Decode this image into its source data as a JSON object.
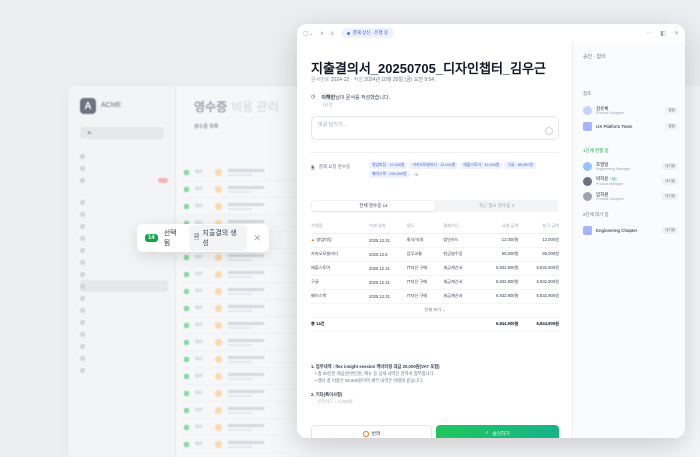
{
  "background": {
    "workspace": "ACME",
    "page_title": "영수증",
    "page_subtitle": "비용 관리",
    "tab_label": "영수증 목록",
    "row_status": "대기"
  },
  "toolbar": {
    "count": "14",
    "selected_label": "선택됨",
    "chip_label": "지출결의 생성"
  },
  "modal": {
    "status": "결재 상신 · 진행 중",
    "title": "지출결의서_20250705_디자인챕터_김우근",
    "meta_prefix": "문서번호",
    "doc_no": "2024-12",
    "meta_date_label": "작성",
    "meta_date": "2024년 10월 20일 (금) 오전 9:54",
    "activity_author": "이해빈",
    "activity_text": "님이 문서를 작성했습니다.",
    "activity_time": "1일 전",
    "comment_placeholder": "댓글 남기기…",
    "linked_label": "결재 요청 영수증",
    "linked_chips": [
      "영업미팅 · 12,000원",
      "카카오모빌리티 · 12,000원",
      "애플스토어 · 12,000원",
      "구글 · 89,000원",
      "페이스북 · 230,000원"
    ],
    "linked_more": "+9",
    "segments": [
      "전체 영수증 14",
      "최근 필요 영수증 3"
    ],
    "table": {
      "headers": [
        "가맹점",
        "거래 일자",
        "용도",
        "결제수단",
        "요청 금액",
        "청구 금액"
      ],
      "rows": [
        {
          "merchant": "영업미팅",
          "date": "2025.12.31",
          "purpose": "회식/식대",
          "method": "법인카드",
          "req": "12,000원",
          "claim": "12,000원",
          "warn": true
        },
        {
          "merchant": "카카오모빌리티",
          "date": "2025.12.6",
          "purpose": "업무교통",
          "method": "현금영수증",
          "req": "65,000원",
          "claim": "65,000원",
          "warn": false
        },
        {
          "merchant": "애플스토어",
          "date": "2025.12.31",
          "purpose": "IT자산 구매",
          "method": "세금계산서",
          "req": "6,832,900원",
          "claim": "6,832,900원",
          "warn": false
        },
        {
          "merchant": "구글",
          "date": "2025.12.31",
          "purpose": "IT자산 구매",
          "method": "세금계산서",
          "req": "6,832,900원",
          "claim": "6,832,900원",
          "warn": false
        },
        {
          "merchant": "페이스북",
          "date": "2025.12.31",
          "purpose": "IT자산 구매",
          "method": "세금계산서",
          "req": "6,832,900원",
          "claim": "6,832,900원",
          "warn": false
        }
      ],
      "more_label": "전체 보기",
      "total_label": "총 14건",
      "total_req": "6,844,900원",
      "total_claim": "6,844,900원"
    },
    "notes": {
      "h1": "1. 업무내역 : flex insight session 케이터링 대금 20,000원(VAT 포함)",
      "s1": "• 총 00인분 제공(변경인원, 메뉴 등 상세 내역은 견적서 첨부합니다.",
      "s2": "• 행사 총 비용은 00,650원이며 세부 내역은 아래와 같습니다.",
      "h2": "2. 기타(특이사항)",
      "s3": "- 신한카드 ↑ 1,500원"
    },
    "reject_label": "반려",
    "approve_label": "승인하기"
  },
  "panel": {
    "title": "승인 · 합의",
    "ref_label": "참조",
    "refs": [
      {
        "name": "김유록",
        "role": "Product Designer",
        "tag": "열람"
      },
      {
        "name": "UX Platform Team",
        "role": "",
        "tag": "열람"
      }
    ],
    "step1_label": "1단계 진행 중",
    "step1": [
      {
        "name": "조영일",
        "role": "Engineering Manager",
        "tag": "대기중",
        "badge": ""
      },
      {
        "name": "박지윤",
        "role": "Product Manager",
        "tag": "대기중",
        "badge": "나"
      },
      {
        "name": "임지원",
        "role": "Product Designer",
        "tag": "대기중",
        "badge": ""
      }
    ],
    "step2_label": "2단계 대기 중",
    "step2": [
      {
        "name": "Engineering Chapter",
        "role": "",
        "tag": "대기중"
      }
    ]
  }
}
